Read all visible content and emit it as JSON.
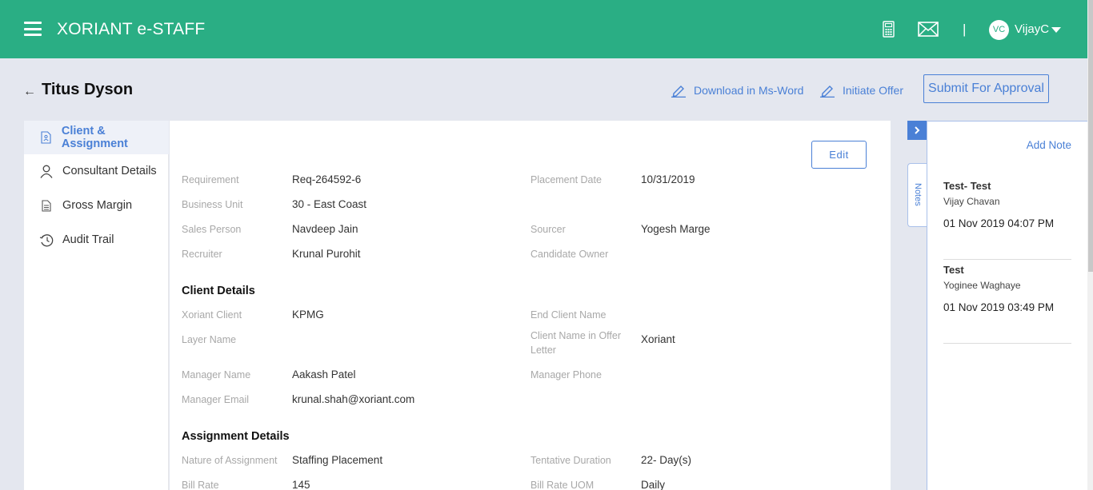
{
  "header": {
    "app_title": "XORIANT e-STAFF",
    "user_initials": "VC",
    "user_name": "VijayC",
    "separator": "|",
    "icons": [
      "menu-icon",
      "calculator-icon",
      "mail-icon",
      "caret-down-icon"
    ]
  },
  "page": {
    "title": "Titus Dyson",
    "download_label": "Download in Ms-Word",
    "initiate_label": "Initiate Offer",
    "submit_label": "Submit For Approval"
  },
  "nav": {
    "items": [
      {
        "label": "Client & Assignment",
        "icon": "document-user-icon",
        "active": true
      },
      {
        "label": "Consultant Details",
        "icon": "person-icon",
        "active": false
      },
      {
        "label": "Gross Margin",
        "icon": "document-icon",
        "active": false
      },
      {
        "label": "Audit Trail",
        "icon": "history-icon",
        "active": false
      }
    ]
  },
  "main": {
    "edit_label": "Edit",
    "fields": {
      "requirement": {
        "label": "Requirement",
        "value": "Req-264592-6"
      },
      "placement_date": {
        "label": "Placement Date",
        "value": "10/31/2019"
      },
      "business_unit": {
        "label": "Business Unit",
        "value": "30 - East Coast"
      },
      "sales_person": {
        "label": "Sales Person",
        "value": "Navdeep Jain"
      },
      "sourcer": {
        "label": "Sourcer",
        "value": "Yogesh Marge"
      },
      "recruiter": {
        "label": "Recruiter",
        "value": "Krunal Purohit"
      },
      "candidate_owner": {
        "label": "Candidate Owner",
        "value": ""
      }
    },
    "client_details": {
      "heading": "Client Details",
      "xoriant_client": {
        "label": "Xoriant Client",
        "value": "KPMG"
      },
      "end_client_name": {
        "label": "End Client Name",
        "value": ""
      },
      "layer_name": {
        "label": "Layer Name",
        "value": ""
      },
      "client_name_offer": {
        "label_line1": "Client Name in Offer",
        "label_line2": "Letter",
        "value": "Xoriant"
      },
      "manager_name": {
        "label": "Manager Name",
        "value": "Aakash Patel"
      },
      "manager_phone": {
        "label": "Manager Phone",
        "value": ""
      },
      "manager_email": {
        "label": "Manager Email",
        "value": "krunal.shah@xoriant.com"
      }
    },
    "assignment_details": {
      "heading": "Assignment Details",
      "nature": {
        "label": "Nature of Assignment",
        "value": "Staffing Placement"
      },
      "tentative_duration": {
        "label": "Tentative Duration",
        "value": "22- Day(s)"
      },
      "bill_rate": {
        "label": "Bill Rate",
        "value": "145"
      },
      "bill_rate_uom": {
        "label": "Bill Rate UOM",
        "value": "Daily"
      }
    }
  },
  "notes": {
    "tab_label": "Notes",
    "add_label": "Add Note",
    "items": [
      {
        "title": "Test- Test",
        "author": "Vijay Chavan",
        "date": "01 Nov 2019 04:07 PM"
      },
      {
        "title": "Test",
        "author": "Yoginee Waghaye",
        "date": "01 Nov 2019 03:49 PM"
      }
    ]
  },
  "colors": {
    "brand": "#2aae84",
    "accent": "#4a80d6",
    "background": "#e4e7ef"
  }
}
